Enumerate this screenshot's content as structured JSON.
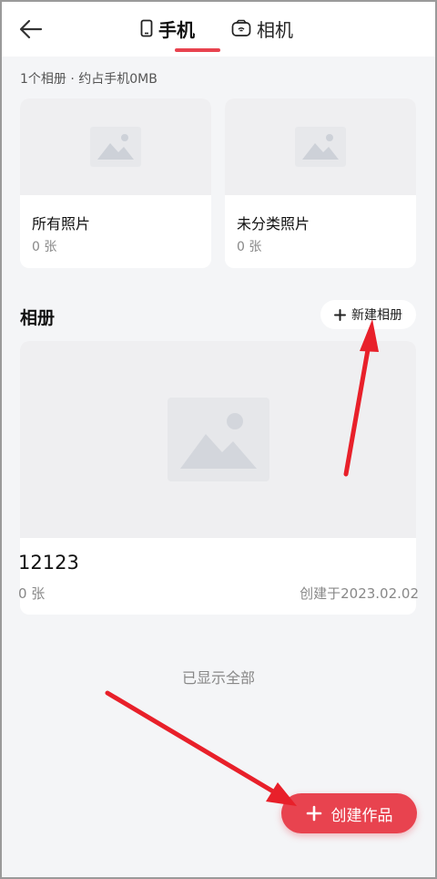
{
  "header": {
    "tabs": [
      {
        "label": "手机",
        "icon": "phone-icon"
      },
      {
        "label": "相机",
        "icon": "camera-icon"
      }
    ]
  },
  "summary": "1个相册 · 约占手机0MB",
  "quick_albums": [
    {
      "name": "所有照片",
      "count": "0 张"
    },
    {
      "name": "未分类照片",
      "count": "0 张"
    }
  ],
  "albums_section": {
    "title": "相册",
    "new_button_label": "新建相册"
  },
  "albums": [
    {
      "name": "12123",
      "count": "0 张",
      "created": "创建于2023.02.02"
    }
  ],
  "footer": "已显示全部",
  "fab_label": "创建作品",
  "colors": {
    "accent": "#e8434f",
    "annotation_arrow": "#e8202a"
  }
}
